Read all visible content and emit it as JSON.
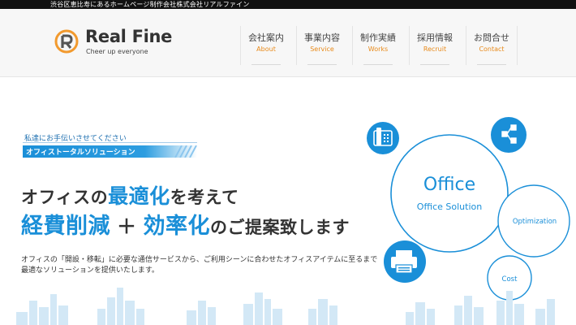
{
  "topbar": {
    "text": "渋谷区恵比寿にあるホームページ制作会社株式会社リアルファイン"
  },
  "logo": {
    "brand": "Real Fine",
    "tagline": "Cheer up everyone"
  },
  "nav": [
    {
      "jp": "会社案内",
      "en": "About"
    },
    {
      "jp": "事業内容",
      "en": "Service"
    },
    {
      "jp": "制作実績",
      "en": "Works"
    },
    {
      "jp": "採用情報",
      "en": "Recruit"
    },
    {
      "jp": "お問合せ",
      "en": "Contact"
    }
  ],
  "hero": {
    "tag_small": "私達にお手伝いさせてください",
    "tag_label": "オフィストータルソリューション",
    "headline1_hl": "最適化",
    "headline1_pre": "オフィスの",
    "headline1_post": "を考えて",
    "headline2_hl1": "経費削減",
    "headline2_plus": "＋",
    "headline2_hl2": "効率化",
    "headline2_post": "のご提案致します",
    "desc_line1": "オフィスの「開設・移転」に必要な通信サービスから、ご利用シーンに合わせたオフィスアイテムに至るまで",
    "desc_line2": "最適なソリューションを提供いたします。"
  },
  "diagram": {
    "main_title": "Office",
    "main_sub": "Office Solution",
    "circle_optimization": "Optimization",
    "circle_cost": "Cost",
    "icons": [
      "phone-icon",
      "network-icon",
      "printer-icon"
    ]
  },
  "colors": {
    "accent": "#1a8fd8",
    "nav_en": "#e88a1a",
    "logo_orange": "#f29a2e"
  }
}
